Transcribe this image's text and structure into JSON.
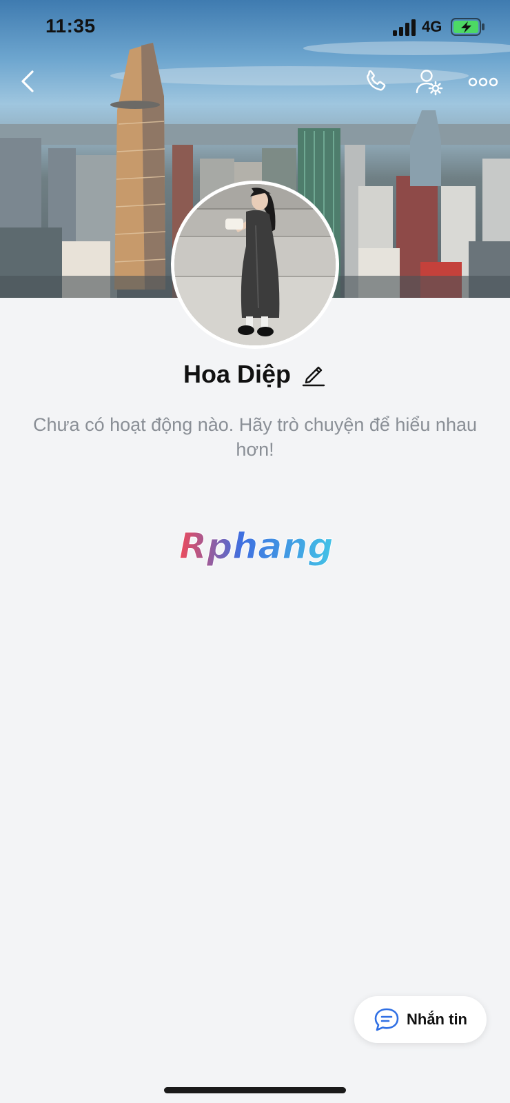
{
  "status_bar": {
    "time": "11:35",
    "network": "4G",
    "battery_state": "charging",
    "battery_color": "#4cd964"
  },
  "top_nav": {
    "icons": [
      "back-chevron-icon",
      "phone-icon",
      "user-settings-icon",
      "more-horizontal-icon"
    ]
  },
  "profile": {
    "name": "Hoa Diệp",
    "edit_icon": "pencil-icon"
  },
  "activity": {
    "empty_message": "Chưa có hoạt động nào. Hãy trò chuyện để hiểu nhau hơn!"
  },
  "watermark": {
    "text": "Rphang",
    "colors": [
      "#ef4a5a",
      "#3f6fe0",
      "#43c3e6"
    ]
  },
  "message_button": {
    "label": "Nhắn tin",
    "icon": "chat-bubble-icon",
    "icon_color": "#2f6fe4"
  }
}
